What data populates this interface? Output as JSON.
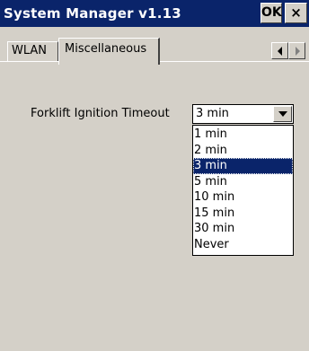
{
  "window": {
    "title": "System Manager v1.13",
    "ok_label": "OK",
    "close_label": "×"
  },
  "tabs": [
    {
      "label": "WLAN",
      "active": false
    },
    {
      "label": "Miscellaneous",
      "active": true
    }
  ],
  "tab_scroll": {
    "left_icon": "arrow-left-icon",
    "right_icon": "arrow-right-icon"
  },
  "settings": {
    "ignition_timeout": {
      "label": "Forklift Ignition Timeout",
      "value": "3 min",
      "options": [
        "1 min",
        "2 min",
        "3 min",
        "5 min",
        "10 min",
        "15 min",
        "30 min",
        "Never"
      ],
      "selected_index": 2
    }
  },
  "colors": {
    "titlebar": "#0a246a",
    "face": "#d4d0c8",
    "selection": "#0a246a"
  }
}
